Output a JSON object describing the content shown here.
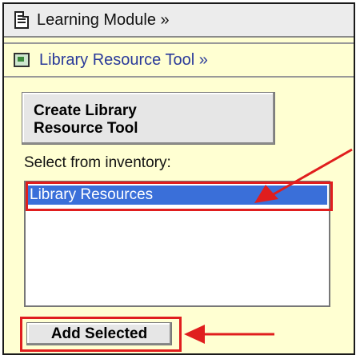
{
  "header": {
    "title": "Learning Module »",
    "icon": "document-icon"
  },
  "module": {
    "title": "Library Resource Tool »",
    "icon": "tool-icon"
  },
  "actions": {
    "create_label": "Create Library\nResource Tool",
    "add_label": "Add Selected"
  },
  "inventory": {
    "label": "Select from inventory:",
    "items": [
      {
        "label": "Library Resources",
        "selected": true
      }
    ]
  },
  "colors": {
    "panel_bg": "#ffffd2",
    "header_bg": "#ececec",
    "link_blue": "#2a3a9a",
    "selection_blue": "#3a6fd9",
    "annotation_red": "#e01e1e"
  }
}
